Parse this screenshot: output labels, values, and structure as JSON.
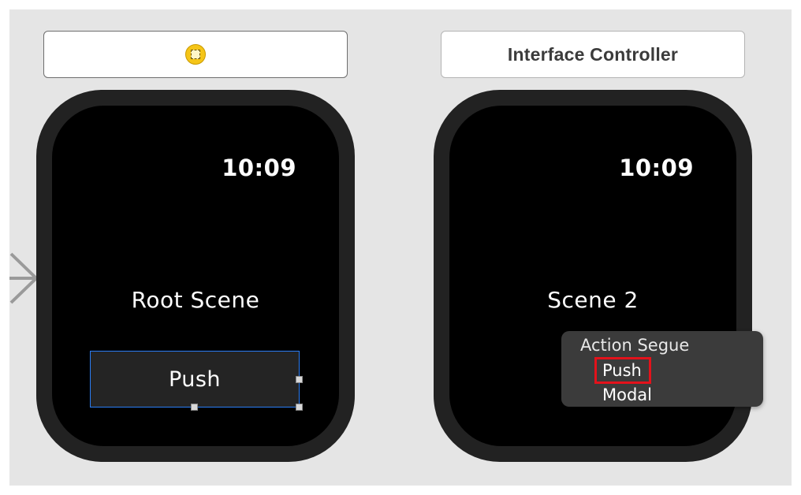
{
  "left_scene": {
    "header_icon": "interface-controller-icon",
    "time": "10:09",
    "title": "Root Scene",
    "button_label": "Push"
  },
  "right_scene": {
    "header_title": "Interface Controller",
    "time": "10:09",
    "title": "Scene 2"
  },
  "segue_menu": {
    "heading": "Action Segue",
    "items": [
      "Push",
      "Modal"
    ],
    "highlighted_item": "Push"
  },
  "colors": {
    "selection_blue": "#2a7df6",
    "highlight_red": "#e3121b",
    "icon_yellow": "#f5c518"
  }
}
